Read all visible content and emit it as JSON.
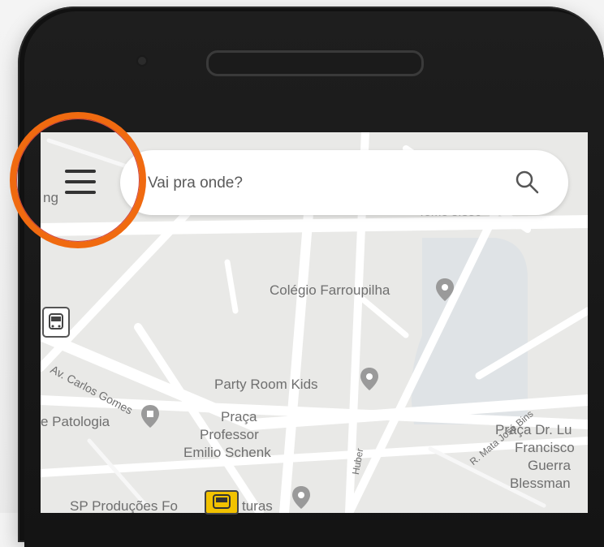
{
  "search": {
    "placeholder": "Vai pra onde?"
  },
  "colors": {
    "highlight": "#f06a10",
    "map_bg": "#e8e8e6",
    "road": "#ffffff",
    "water": "#dfe3e6",
    "pin": "#9a9a9a",
    "taxi": "#f2c200"
  },
  "icons": [
    "menu-icon",
    "search-icon",
    "bus-stop-icon",
    "taxi-stop-icon",
    "place-pin-icon"
  ],
  "map": {
    "labels": {
      "ng": "ng",
      "colegio": "Colégio Farroupilha",
      "party": "Party Room Kids",
      "carlos": "Av. Carlos Gomes",
      "patologia": "e Patologia",
      "praca1": "Praça",
      "praca2": "Professor",
      "praca3": "Emilio Schenk",
      "mata": "R. Mata José Bins",
      "pdl1": "Praça Dr. Lu",
      "pdl2": "Francisco",
      "pdl3": "Guerra",
      "pdl4": "Blessman",
      "sp": "SP Produções Fo",
      "turas": "turas",
      "huber": "Huber",
      "top_faded": "Tomé 8.850"
    }
  }
}
